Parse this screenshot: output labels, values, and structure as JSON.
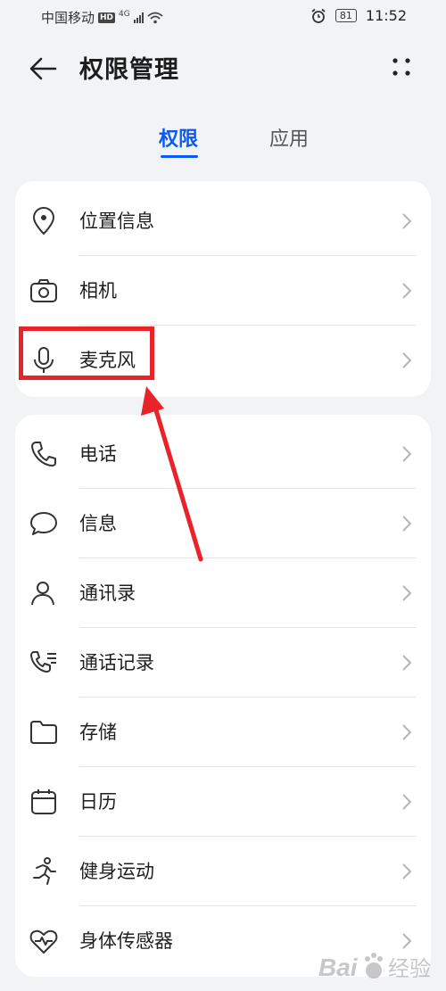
{
  "status_bar": {
    "carrier": "中国移动",
    "hd_badge": "HD",
    "network": "4G",
    "battery": "81",
    "time": "11:52"
  },
  "header": {
    "title": "权限管理",
    "back_icon": "arrow-left-icon",
    "more_icon": "more-dots-icon"
  },
  "tabs": {
    "permissions": "权限",
    "apps": "应用",
    "active": "permissions",
    "accent_color": "#0a59f7"
  },
  "group1": [
    {
      "label": "位置信息",
      "icon": "location-pin-icon"
    },
    {
      "label": "相机",
      "icon": "camera-icon"
    },
    {
      "label": "麦克风",
      "icon": "microphone-icon"
    }
  ],
  "group2": [
    {
      "label": "电话",
      "icon": "phone-icon"
    },
    {
      "label": "信息",
      "icon": "message-bubble-icon"
    },
    {
      "label": "通讯录",
      "icon": "contacts-icon"
    },
    {
      "label": "通话记录",
      "icon": "call-log-icon"
    },
    {
      "label": "存储",
      "icon": "folder-icon"
    },
    {
      "label": "日历",
      "icon": "calendar-icon"
    },
    {
      "label": "健身运动",
      "icon": "running-icon"
    },
    {
      "label": "身体传感器",
      "icon": "heart-sensor-icon"
    }
  ],
  "annotation": {
    "highlighted_item": "麦克风",
    "color": "#e8232a"
  },
  "watermark": {
    "brand": "Bai",
    "suffix": "经验"
  }
}
